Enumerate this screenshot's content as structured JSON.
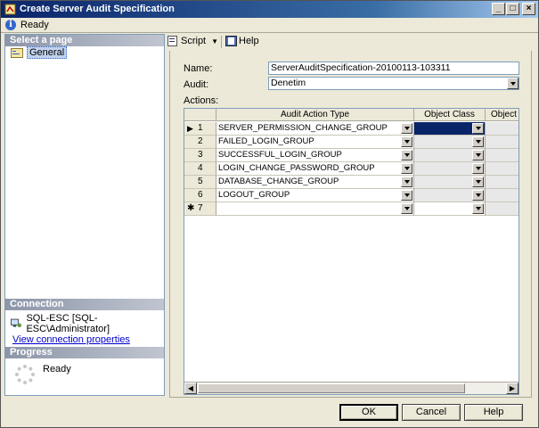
{
  "window": {
    "title": "Create Server Audit Specification",
    "status": "Ready"
  },
  "left_pane": {
    "select_page_header": "Select a page",
    "pages": [
      {
        "label": "General",
        "icon": "properties-page-icon",
        "selected": true
      }
    ],
    "connection_header": "Connection",
    "connection": "SQL-ESC [SQL-ESC\\Administrator]",
    "view_connection_link": "View connection properties",
    "progress_header": "Progress",
    "progress_status": "Ready"
  },
  "toolbar": {
    "script_label": "Script",
    "help_label": "Help"
  },
  "form": {
    "name_label": "Name:",
    "name_value": "ServerAuditSpecification-20100113-103311",
    "audit_label": "Audit:",
    "audit_value": "Denetim",
    "actions_label": "Actions:"
  },
  "grid": {
    "columns": [
      "",
      "Audit Action Type",
      "Object Class",
      "Object"
    ],
    "rows": [
      {
        "num": "1",
        "action": "SERVER_PERMISSION_CHANGE_GROUP",
        "current": true
      },
      {
        "num": "2",
        "action": "FAILED_LOGIN_GROUP"
      },
      {
        "num": "3",
        "action": "SUCCESSFUL_LOGIN_GROUP"
      },
      {
        "num": "4",
        "action": "LOGIN_CHANGE_PASSWORD_GROUP"
      },
      {
        "num": "5",
        "action": "DATABASE_CHANGE_GROUP"
      },
      {
        "num": "6",
        "action": "LOGOUT_GROUP"
      },
      {
        "num": "7",
        "action": "",
        "new_row": true
      }
    ]
  },
  "buttons": {
    "ok": "OK",
    "cancel": "Cancel",
    "help": "Help"
  },
  "colors": {
    "title_bar": "#0a246a",
    "selection": "#0a246a",
    "link": "#0000cc"
  }
}
